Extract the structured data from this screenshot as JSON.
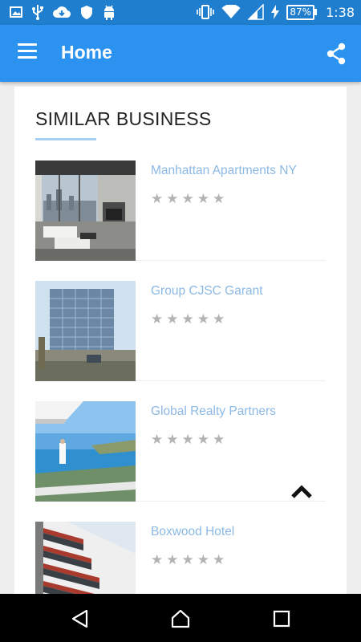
{
  "status_bar": {
    "battery": "87%",
    "time": "1:38",
    "icons": [
      "image-icon",
      "usb-icon",
      "cloud-download-icon",
      "shield-icon",
      "android-icon",
      "vibrate-icon",
      "wifi-icon",
      "signal-icon",
      "charging-icon",
      "battery-icon"
    ]
  },
  "app_bar": {
    "title": "Home",
    "left_icon": "menu-icon",
    "right_icon": "share-icon"
  },
  "section": {
    "title": "SIMILAR BUSINESS"
  },
  "businesses": [
    {
      "name": "Manhattan Apartments NY",
      "rating": 0
    },
    {
      "name": "Group CJSC Garant",
      "rating": 0
    },
    {
      "name": "Global Realty Partners",
      "rating": 0
    },
    {
      "name": "Boxwood Hotel",
      "rating": 0
    }
  ],
  "colors": {
    "status_bar": "#1f7fce",
    "app_bar": "#2b93ef",
    "link_text": "#8cb9e4",
    "star_empty": "#b3b3b3"
  },
  "nav_bar": {
    "icons": [
      "back-icon",
      "home-icon",
      "recents-icon"
    ]
  }
}
